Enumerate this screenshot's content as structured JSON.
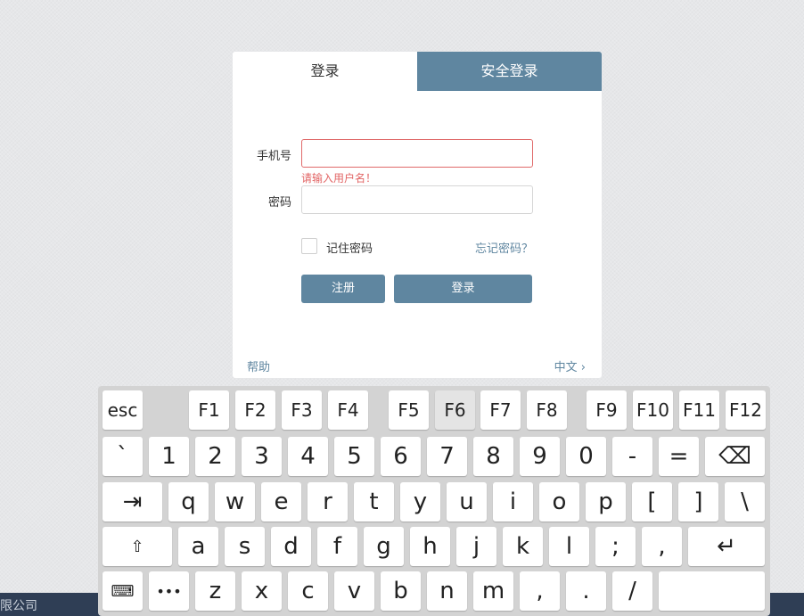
{
  "login": {
    "tabs": {
      "login": "登录",
      "secure_login": "安全登录"
    },
    "phone_label": "手机号",
    "phone_value": "",
    "phone_error": "请输入用户名！",
    "password_label": "密码",
    "password_value": "",
    "remember_label": "记住密码",
    "forgot_link": "忘记密码？",
    "register_button": "注册",
    "login_button": "登录",
    "help_link": "帮助",
    "language": "中文 ›"
  },
  "footer": {
    "text": "限公司"
  },
  "keyboard": {
    "pressed_key": "F6",
    "icons": {
      "tab": "tab-icon",
      "shift": "shift-icon",
      "backspace": "backspace-icon",
      "enter": "enter-icon",
      "keyboard": "keyboard-icon",
      "more": "more-icon"
    },
    "rows": [
      [
        "esc",
        "F1",
        "F2",
        "F3",
        "F4",
        "F5",
        "F6",
        "F7",
        "F8",
        "F9",
        "F10",
        "F11",
        "F12"
      ],
      [
        "`",
        "1",
        "2",
        "3",
        "4",
        "5",
        "6",
        "7",
        "8",
        "9",
        "0",
        "-",
        "=",
        "⌫"
      ],
      [
        "⇥",
        "q",
        "w",
        "e",
        "r",
        "t",
        "y",
        "u",
        "i",
        "o",
        "p",
        "[",
        "]",
        "\\"
      ],
      [
        "⇧",
        "a",
        "s",
        "d",
        "f",
        "g",
        "h",
        "j",
        "k",
        "l",
        ";",
        ",",
        "↵"
      ],
      [
        "⌨",
        "•••",
        "z",
        "x",
        "c",
        "v",
        "b",
        "n",
        "m",
        ",",
        ".",
        "/",
        ""
      ]
    ]
  },
  "colors": {
    "accent": "#5f86a0",
    "error": "#e26464",
    "footer": "#2f3e55"
  }
}
